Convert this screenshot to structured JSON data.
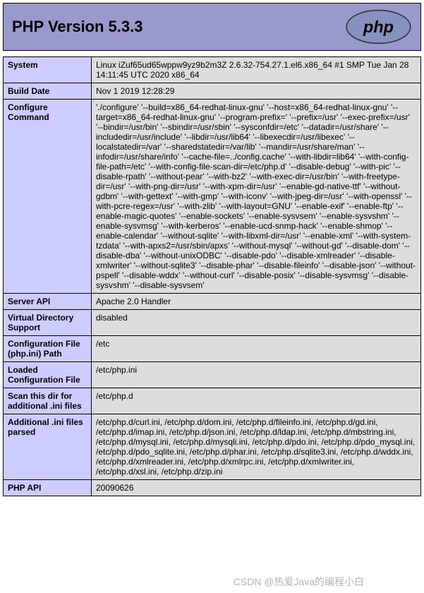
{
  "header": {
    "title": "PHP Version 5.3.3",
    "logo_alt": "php"
  },
  "rows": [
    {
      "label": "System",
      "value": "Linux iZuf65ud65wppw9yz9b2m3Z 2.6.32-754.27.1.el6.x86_64 #1 SMP Tue Jan 28 14:11:45 UTC 2020 x86_64"
    },
    {
      "label": "Build Date",
      "value": "Nov 1 2019 12:28:29"
    },
    {
      "label": "Configure Command",
      "value": "'./configure'  '--build=x86_64-redhat-linux-gnu' '--host=x86_64-redhat-linux-gnu' '--target=x86_64-redhat-linux-gnu' '--program-prefix=' '--prefix=/usr' '--exec-prefix=/usr' '--bindir=/usr/bin' '--sbindir=/usr/sbin' '--sysconfdir=/etc' '--datadir=/usr/share' '--includedir=/usr/include' '--libdir=/usr/lib64' '--libexecdir=/usr/libexec' '--localstatedir=/var' '--sharedstatedir=/var/lib' '--mandir=/usr/share/man' '--infodir=/usr/share/info' '--cache-file=../config.cache' '--with-libdir=lib64' '--with-config-file-path=/etc' '--with-config-file-scan-dir=/etc/php.d' '--disable-debug' '--with-pic' '--disable-rpath' '--without-pear' '--with-bz2' '--with-exec-dir=/usr/bin' '--with-freetype-dir=/usr' '--with-png-dir=/usr' '--with-xpm-dir=/usr' '--enable-gd-native-ttf' '--without-gdbm' '--with-gettext' '--with-gmp' '--with-iconv' '--with-jpeg-dir=/usr' '--with-openssl' '--with-pcre-regex=/usr' '--with-zlib' '--with-layout=GNU' '--enable-exif' '--enable-ftp' '--enable-magic-quotes' '--enable-sockets' '--enable-sysvsem' '--enable-sysvshm' '--enable-sysvmsg' '--with-kerberos' '--enable-ucd-snmp-hack' '--enable-shmop' '--enable-calendar' '--without-sqlite' '--with-libxml-dir=/usr' '--enable-xml' '--with-system-tzdata' '--with-apxs2=/usr/sbin/apxs' '--without-mysql' '--without-gd' '--disable-dom' '--disable-dba' '--without-unixODBC' '--disable-pdo' '--disable-xmlreader' '--disable-xmlwriter' '--without-sqlite3' '--disable-phar' '--disable-fileinfo' '--disable-json' '--without-pspell' '--disable-wddx' '--without-curl' '--disable-posix' '--disable-sysvmsg' '--disable-sysvshm' '--disable-sysvsem'"
    },
    {
      "label": "Server API",
      "value": "Apache 2.0 Handler"
    },
    {
      "label": "Virtual Directory Support",
      "value": "disabled"
    },
    {
      "label": "Configuration File (php.ini) Path",
      "value": "/etc"
    },
    {
      "label": "Loaded Configuration File",
      "value": "/etc/php.ini"
    },
    {
      "label": "Scan this dir for additional .ini files",
      "value": "/etc/php.d"
    },
    {
      "label": "Additional .ini files parsed",
      "value": "/etc/php.d/curl.ini, /etc/php.d/dom.ini, /etc/php.d/fileinfo.ini, /etc/php.d/gd.ini, /etc/php.d/imap.ini, /etc/php.d/json.ini, /etc/php.d/ldap.ini, /etc/php.d/mbstring.ini, /etc/php.d/mysql.ini, /etc/php.d/mysqli.ini, /etc/php.d/pdo.ini, /etc/php.d/pdo_mysql.ini, /etc/php.d/pdo_sqlite.ini, /etc/php.d/phar.ini, /etc/php.d/sqlite3.ini, /etc/php.d/wddx.ini, /etc/php.d/xmlreader.ini, /etc/php.d/xmlrpc.ini, /etc/php.d/xmlwriter.ini, /etc/php.d/xsl.ini, /etc/php.d/zip.ini"
    },
    {
      "label": "PHP API",
      "value": "20090626"
    }
  ],
  "watermark": "CSDN @热爱Java的编程小白"
}
